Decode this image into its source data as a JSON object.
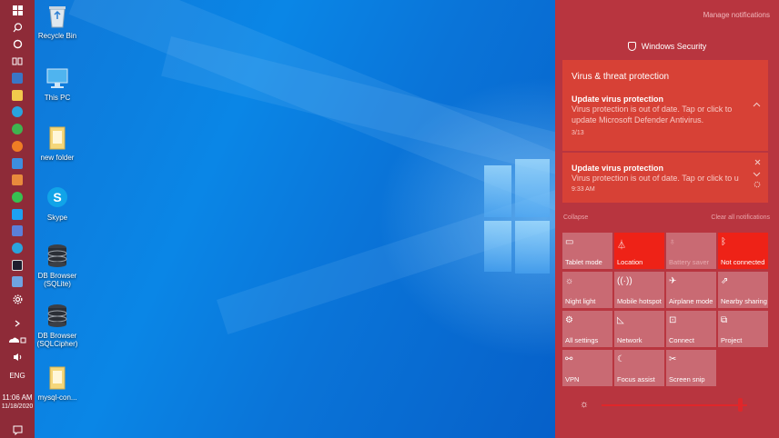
{
  "desktop": {
    "icons": [
      {
        "label": "Recycle Bin",
        "icon": "recycle-bin-icon"
      },
      {
        "label": "This PC",
        "icon": "computer-icon"
      },
      {
        "label": "new folder",
        "icon": "folder-icon"
      },
      {
        "label": "Skype",
        "icon": "skype-icon"
      },
      {
        "label": "DB Browser (SQLite)",
        "icon": "database-icon"
      },
      {
        "label": "DB Browser (SQLCipher)",
        "icon": "database-icon"
      },
      {
        "label": "mysql-con...",
        "icon": "folder-icon"
      }
    ]
  },
  "taskbar": {
    "language": "ENG",
    "time": "11:06 AM",
    "date": "11/18/2020",
    "accent_color": "#8e2b38"
  },
  "action_center": {
    "manage_label": "Manage notifications",
    "app_name": "Windows Security",
    "group_title": "Virus & threat protection",
    "notifications": [
      {
        "title": "Update virus protection",
        "body": "Virus protection is out of date. Tap or click to update Microsoft Defender Antivirus.",
        "time": "3/13"
      },
      {
        "title": "Update virus protection",
        "body": "Virus protection is out of date. Tap or click to u",
        "time": "9:33 AM"
      }
    ],
    "collapse_label": "Collapse",
    "clear_all_label": "Clear all notifications",
    "quick_actions": [
      {
        "label": "Tablet mode",
        "icon": "tablet-icon",
        "state": "off"
      },
      {
        "label": "Location",
        "icon": "location-icon",
        "state": "on"
      },
      {
        "label": "Battery saver",
        "icon": "battery-icon",
        "state": "disabled"
      },
      {
        "label": "Not connected",
        "icon": "bluetooth-icon",
        "state": "on"
      },
      {
        "label": "Night light",
        "icon": "night-light-icon",
        "state": "off"
      },
      {
        "label": "Mobile hotspot",
        "icon": "hotspot-icon",
        "state": "off"
      },
      {
        "label": "Airplane mode",
        "icon": "airplane-icon",
        "state": "off"
      },
      {
        "label": "Nearby sharing",
        "icon": "share-icon",
        "state": "off"
      },
      {
        "label": "All settings",
        "icon": "gear-icon",
        "state": "off"
      },
      {
        "label": "Network",
        "icon": "network-icon",
        "state": "off"
      },
      {
        "label": "Connect",
        "icon": "connect-icon",
        "state": "off"
      },
      {
        "label": "Project",
        "icon": "project-icon",
        "state": "off"
      },
      {
        "label": "VPN",
        "icon": "vpn-icon",
        "state": "off"
      },
      {
        "label": "Focus assist",
        "icon": "moon-icon",
        "state": "off"
      },
      {
        "label": "Screen snip",
        "icon": "scissors-icon",
        "state": "off"
      }
    ],
    "brightness_percent": 96,
    "colors": {
      "panel": "#b8353f",
      "active_tile": "#ee2217",
      "toast": "#d74136"
    }
  }
}
